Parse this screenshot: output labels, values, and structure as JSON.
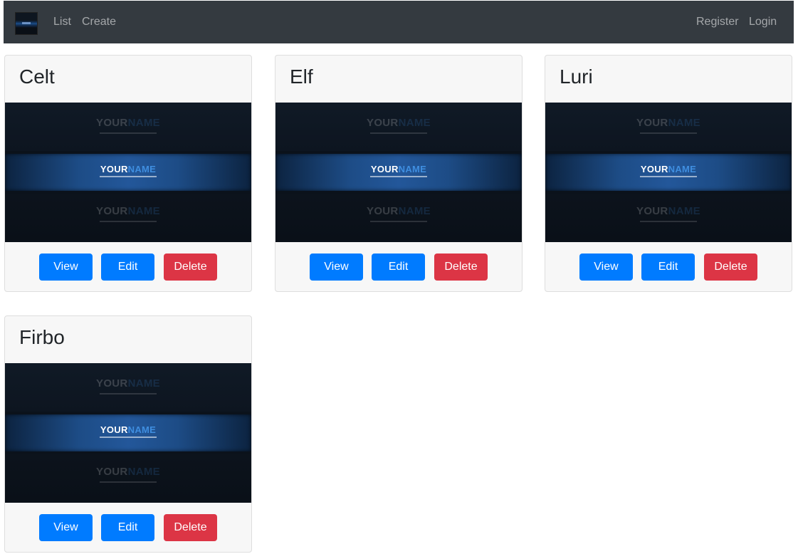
{
  "nav": {
    "links": [
      "List",
      "Create"
    ],
    "auth": [
      "Register",
      "Login"
    ]
  },
  "banner_text": {
    "word1": "YOUR",
    "word2": "NAME"
  },
  "buttons": {
    "view": "View",
    "edit": "Edit",
    "delete": "Delete"
  },
  "cards": [
    {
      "title": "Celt"
    },
    {
      "title": "Elf"
    },
    {
      "title": "Luri"
    },
    {
      "title": "Firbo"
    }
  ],
  "colors": {
    "navbar": "#343a40",
    "primary": "#007bff",
    "danger": "#dc3545",
    "card_bg": "#f7f7f7"
  }
}
